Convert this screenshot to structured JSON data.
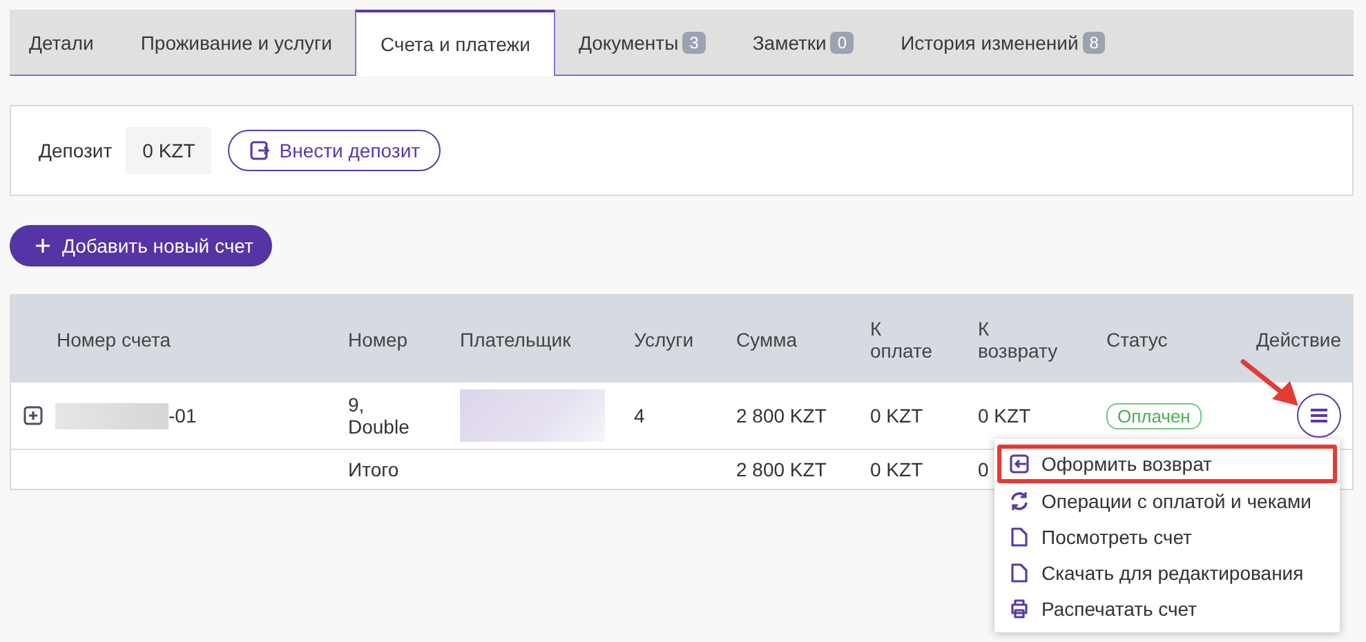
{
  "tabs": [
    {
      "label": "Детали",
      "selected": false
    },
    {
      "label": "Проживание и услуги",
      "selected": false
    },
    {
      "label": "Счета и платежи",
      "selected": true
    },
    {
      "label": "Документы",
      "badge": "3",
      "selected": false
    },
    {
      "label": "Заметки",
      "badge": "0",
      "selected": false
    },
    {
      "label": "История изменений",
      "badge": "8",
      "selected": false
    }
  ],
  "deposit": {
    "label": "Депозит",
    "amount": "0 KZT",
    "button": "Внести депозит"
  },
  "add_invoice_button": "Добавить новый счет",
  "table": {
    "columns": [
      "Номер счета",
      "Номер",
      "Плательщик",
      "Услуги",
      "Сумма",
      "К оплате",
      "К возврату",
      "Статус",
      "Действие"
    ],
    "rows": [
      {
        "invoice_suffix": "-01",
        "invoice_redacted": true,
        "expanded": false,
        "room": "9, Double",
        "payer_redacted": true,
        "services": "4",
        "amount": "2 800 KZT",
        "to_pay": "0 KZT",
        "to_refund": "0 KZT",
        "status": {
          "label": "Оплачен",
          "kind": "paid"
        }
      }
    ],
    "total": {
      "label": "Итого",
      "amount": "2 800 KZT",
      "to_pay": "0 KZT",
      "to_refund": "0"
    }
  },
  "action_menu": {
    "open": true,
    "annotation_arrow": true,
    "items": [
      {
        "label": "Оформить возврат",
        "kind": "refund",
        "highlighted": true
      },
      {
        "label": "Операции с оплатой и чеками",
        "kind": "sync",
        "highlighted": false
      },
      {
        "label": "Посмотреть счет",
        "kind": "file",
        "highlighted": false
      },
      {
        "label": "Скачать для редактирования",
        "kind": "file",
        "highlighted": false
      },
      {
        "label": "Распечатать счет",
        "kind": "print",
        "highlighted": false
      }
    ]
  }
}
